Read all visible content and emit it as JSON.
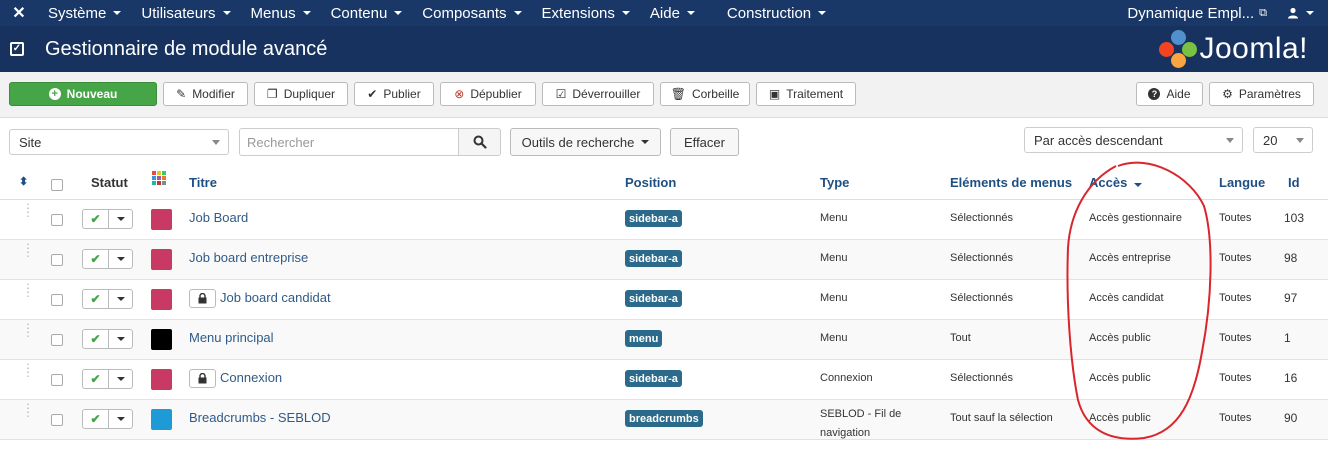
{
  "nav": {
    "menus": [
      {
        "label": "Système"
      },
      {
        "label": "Utilisateurs"
      },
      {
        "label": "Menus"
      },
      {
        "label": "Contenu"
      },
      {
        "label": "Composants"
      },
      {
        "label": "Extensions"
      },
      {
        "label": "Aide"
      },
      {
        "label": "Construction"
      }
    ],
    "site_link": "Dynamique Empl...",
    "user_icon": "user-icon"
  },
  "header": {
    "title": "Gestionnaire de module avancé",
    "brand": "Joomla!"
  },
  "toolbar": {
    "new": "Nouveau",
    "edit": "Modifier",
    "duplicate": "Dupliquer",
    "publish": "Publier",
    "unpublish": "Dépublier",
    "unlock": "Déverrouiller",
    "trash": "Corbeille",
    "batch": "Traitement",
    "help": "Aide",
    "options": "Paramètres"
  },
  "filters": {
    "client": "Site",
    "search_placeholder": "Rechercher",
    "search_tools": "Outils de recherche",
    "clear": "Effacer",
    "ordering": "Par accès descendant",
    "limit": "20"
  },
  "columns": {
    "status": "Statut",
    "title": "Titre",
    "position": "Position",
    "type": "Type",
    "menus": "Eléments de menus",
    "access": "Accès",
    "language": "Langue",
    "id": "Id"
  },
  "rows": [
    {
      "title": "Job Board",
      "color": "#c83a63",
      "locked": false,
      "position": "sidebar-a",
      "type": "Menu",
      "menus": "Sélectionnés",
      "access": "Accès gestionnaire",
      "language": "Toutes",
      "id": "103"
    },
    {
      "title": "Job board entreprise",
      "color": "#c83a63",
      "locked": false,
      "position": "sidebar-a",
      "type": "Menu",
      "menus": "Sélectionnés",
      "access": "Accès entreprise",
      "language": "Toutes",
      "id": "98"
    },
    {
      "title": "Job board candidat",
      "color": "#c83a63",
      "locked": true,
      "position": "sidebar-a",
      "type": "Menu",
      "menus": "Sélectionnés",
      "access": "Accès candidat",
      "language": "Toutes",
      "id": "97"
    },
    {
      "title": "Menu principal",
      "color": "#000000",
      "locked": false,
      "position": "menu",
      "type": "Menu",
      "menus": "Tout",
      "access": "Accès public",
      "language": "Toutes",
      "id": "1"
    },
    {
      "title": "Connexion",
      "color": "#c83a63",
      "locked": true,
      "position": "sidebar-a",
      "type": "Connexion",
      "menus": "Sélectionnés",
      "access": "Accès public",
      "language": "Toutes",
      "id": "16"
    },
    {
      "title": "Breadcrumbs - SEBLOD",
      "color": "#1e9bd7",
      "locked": false,
      "position": "breadcrumbs",
      "type": "SEBLOD - Fil de navigation",
      "menus": "Tout sauf la sélection",
      "access": "Accès public",
      "language": "Toutes",
      "id": "90"
    }
  ],
  "colors": {
    "nav_bg": "#1a3867",
    "header_bg": "#17325e",
    "accent_green": "#46a546",
    "badge": "#2b6a8a",
    "annotation": "#d9262c"
  }
}
